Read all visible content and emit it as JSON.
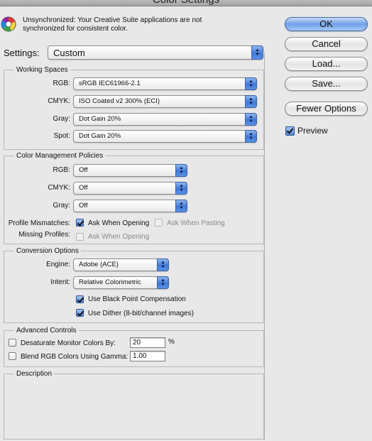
{
  "window": {
    "title": "Color Settings"
  },
  "sync": {
    "message": "Unsynchronized: Your Creative Suite applications are not synchronized for consistent color."
  },
  "settings": {
    "label": "Settings:",
    "value": "Custom"
  },
  "working_spaces": {
    "title": "Working Spaces",
    "rgb": {
      "label": "RGB:",
      "value": "sRGB IEC61966-2.1"
    },
    "cmyk": {
      "label": "CMYK:",
      "value": "ISO Coated v2 300% (ECI)"
    },
    "gray": {
      "label": "Gray:",
      "value": "Dot Gain 20%"
    },
    "spot": {
      "label": "Spot:",
      "value": "Dot Gain 20%"
    }
  },
  "policies": {
    "title": "Color Management Policies",
    "rgb": {
      "label": "RGB:",
      "value": "Off"
    },
    "cmyk": {
      "label": "CMYK:",
      "value": "Off"
    },
    "gray": {
      "label": "Gray:",
      "value": "Off"
    },
    "profile_mismatches": {
      "label": "Profile Mismatches:",
      "ask_opening": {
        "label": "Ask When Opening",
        "checked": true
      },
      "ask_pasting": {
        "label": "Ask When Pasting",
        "checked": false
      }
    },
    "missing_profiles": {
      "label": "Missing Profiles:",
      "ask_opening": {
        "label": "Ask When Opening",
        "checked": false
      }
    }
  },
  "conversion": {
    "title": "Conversion Options",
    "engine": {
      "label": "Engine:",
      "value": "Adobe (ACE)"
    },
    "intent": {
      "label": "Intent:",
      "value": "Relative Colorimetric"
    },
    "black_point": {
      "label": "Use Black Point Compensation",
      "checked": true
    },
    "dither": {
      "label": "Use Dither (8-bit/channel images)",
      "checked": true
    }
  },
  "advanced": {
    "title": "Advanced Controls",
    "desaturate": {
      "label": "Desaturate Monitor Colors By:",
      "value": "20",
      "unit": "%",
      "checked": false
    },
    "blend": {
      "label": "Blend RGB Colors Using Gamma:",
      "value": "1.00",
      "checked": false
    }
  },
  "description": {
    "title": "Description"
  },
  "buttons": {
    "ok": "OK",
    "cancel": "Cancel",
    "load": "Load...",
    "save": "Save...",
    "fewer_options": "Fewer Options"
  },
  "preview": {
    "label": "Preview",
    "checked": true
  },
  "colors": {
    "accent": "#4d85dc",
    "default_button": "#6fa0e8",
    "panel": "#e8e8e8"
  }
}
